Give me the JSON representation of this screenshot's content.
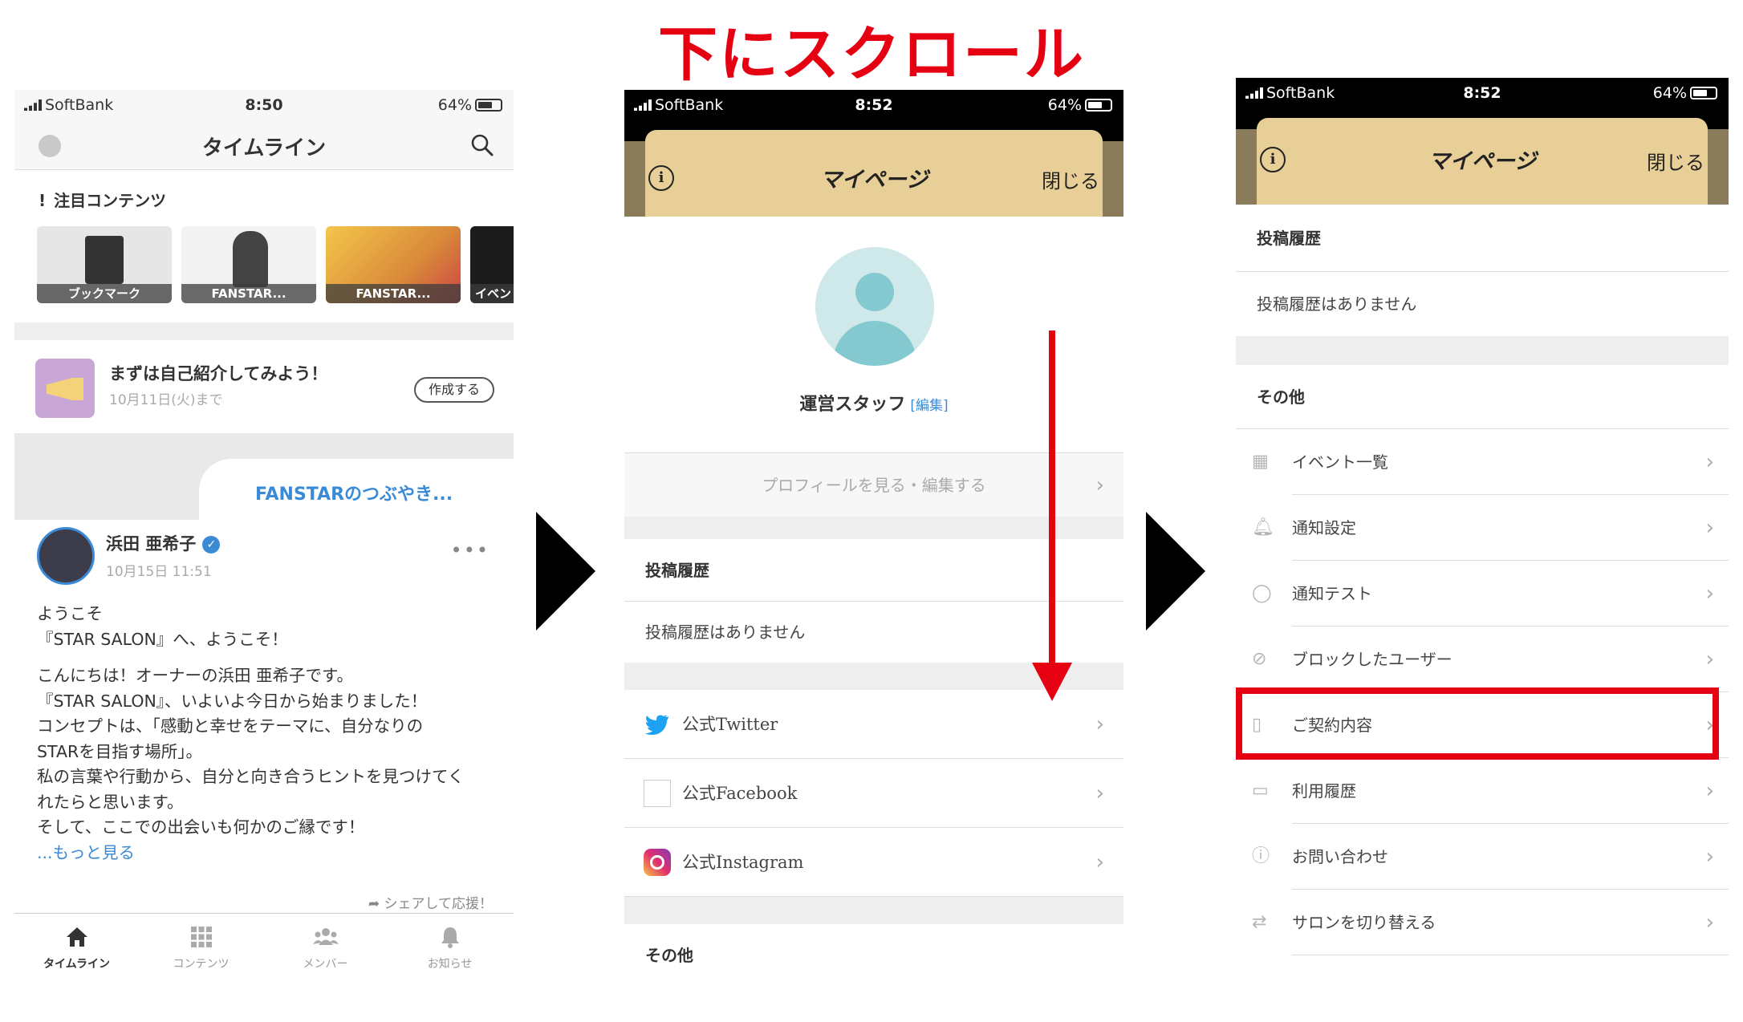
{
  "headline": "下にスクロール",
  "colors": {
    "accent_red": "#e50012",
    "link_blue": "#3a8ad6",
    "gold": "#e8cf98"
  },
  "panel1": {
    "status": {
      "carrier": "SoftBank",
      "time": "8:50",
      "battery": "64%"
    },
    "header_title": "タイムライン",
    "featured_title": "注目コンテンツ",
    "thumbnails": [
      "ブックマーク",
      "FANSTAR...",
      "FANSTAR...",
      "イベン"
    ],
    "intro": {
      "title": "まずは自己紹介してみよう！",
      "date": "10月11日(火)まで",
      "button": "作成する"
    },
    "tab_label": "FANSTARのつぶやき...",
    "post": {
      "name": "浜田 亜希子",
      "date": "10月15日 11:51",
      "lines1": [
        "ようこそ",
        "『STAR SALON』へ、ようこそ！"
      ],
      "lines2": [
        "こんにちは！オーナーの浜田 亜希子です。",
        "『STAR SALON』、いよいよ今日から始まりました！",
        "コンセプトは、「感動と幸せをテーマに、自分なりの",
        "STARを目指す場所」。",
        "私の言葉や行動から、自分と向き合うヒントを見つけてく",
        "れたらと思います。",
        "そして、ここでの出会いも何かのご縁です！"
      ],
      "read_more": "...もっと見る",
      "share": "シェアして応援！"
    },
    "nav": [
      "タイムライン",
      "コンテンツ",
      "メンバー",
      "お知らせ"
    ]
  },
  "panel2": {
    "status": {
      "carrier": "SoftBank",
      "time": "8:52",
      "battery": "64%"
    },
    "title": "マイページ",
    "close": "閉じる",
    "profile_name": "運営スタッフ",
    "edit": "[編集]",
    "profile_button": "プロフィールを見る・編集する",
    "posts_head": "投稿履歴",
    "posts_empty": "投稿履歴はありません",
    "links": [
      "公式Twitter",
      "公式Facebook",
      "公式Instagram"
    ],
    "other_head": "その他"
  },
  "panel3": {
    "status": {
      "carrier": "SoftBank",
      "time": "8:52",
      "battery": "64%"
    },
    "title": "マイページ",
    "close": "閉じる",
    "posts_head": "投稿履歴",
    "posts_empty": "投稿履歴はありません",
    "other_head": "その他",
    "menu": [
      "イベント一覧",
      "通知設定",
      "通知テスト",
      "ブロックしたユーザー",
      "ご契約内容",
      "利用履歴",
      "お問い合わせ",
      "サロンを切り替える"
    ]
  }
}
